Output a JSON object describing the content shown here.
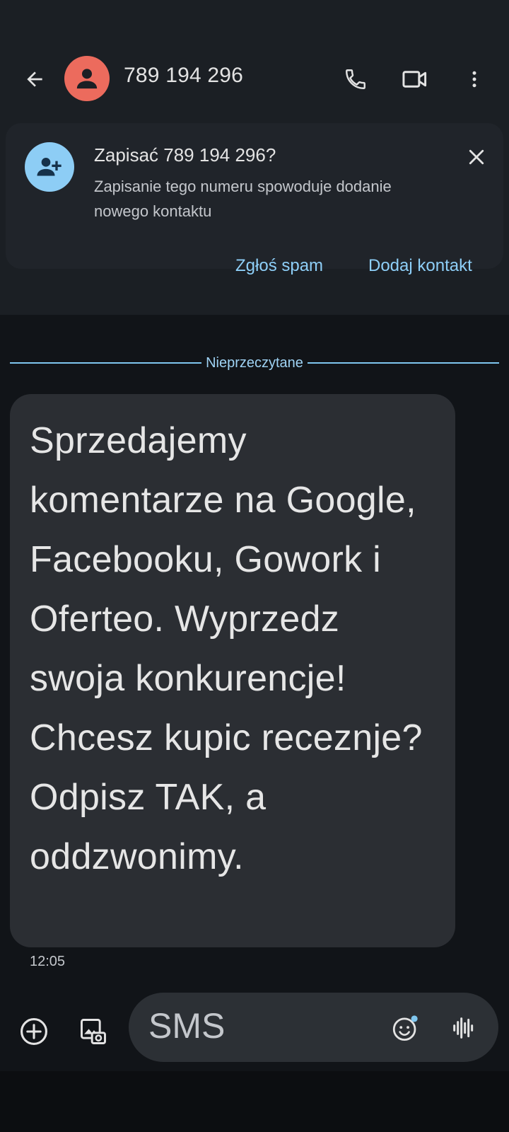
{
  "header": {
    "contact_number": "789 194 296",
    "icons": [
      "arrow-back-icon",
      "person-icon",
      "phone-icon",
      "video-camera-icon",
      "more-vertical-icon"
    ]
  },
  "banner": {
    "title": "Zapisać 789 194 296?",
    "description": "Zapisanie tego numeru spowoduje dodanie nowego kontaktu",
    "report_spam_label": "Zgłoś spam",
    "add_contact_label": "Dodaj kontakt",
    "icons": [
      "person-add-icon",
      "close-icon"
    ]
  },
  "conversation": {
    "unread_label": "Nieprzeczytane",
    "messages": [
      {
        "text": "Sprzedajemy komentarze na Google, Facebooku, Gowork i Oferteo. Wyprzedz swoja konkurencje! Chcesz kupic receznje? Odpisz TAK, a oddzwonimy.",
        "time": "12:05"
      }
    ]
  },
  "composer": {
    "placeholder": "SMS",
    "icons": [
      "add-circle-icon",
      "gallery-icon",
      "emoji-icon",
      "voice-icon"
    ]
  },
  "colors": {
    "avatar": "#ec6b5d",
    "accent": "#8ecff8",
    "background": "#111418",
    "surface": "#1b1f24",
    "bubble": "#2b2e33"
  }
}
